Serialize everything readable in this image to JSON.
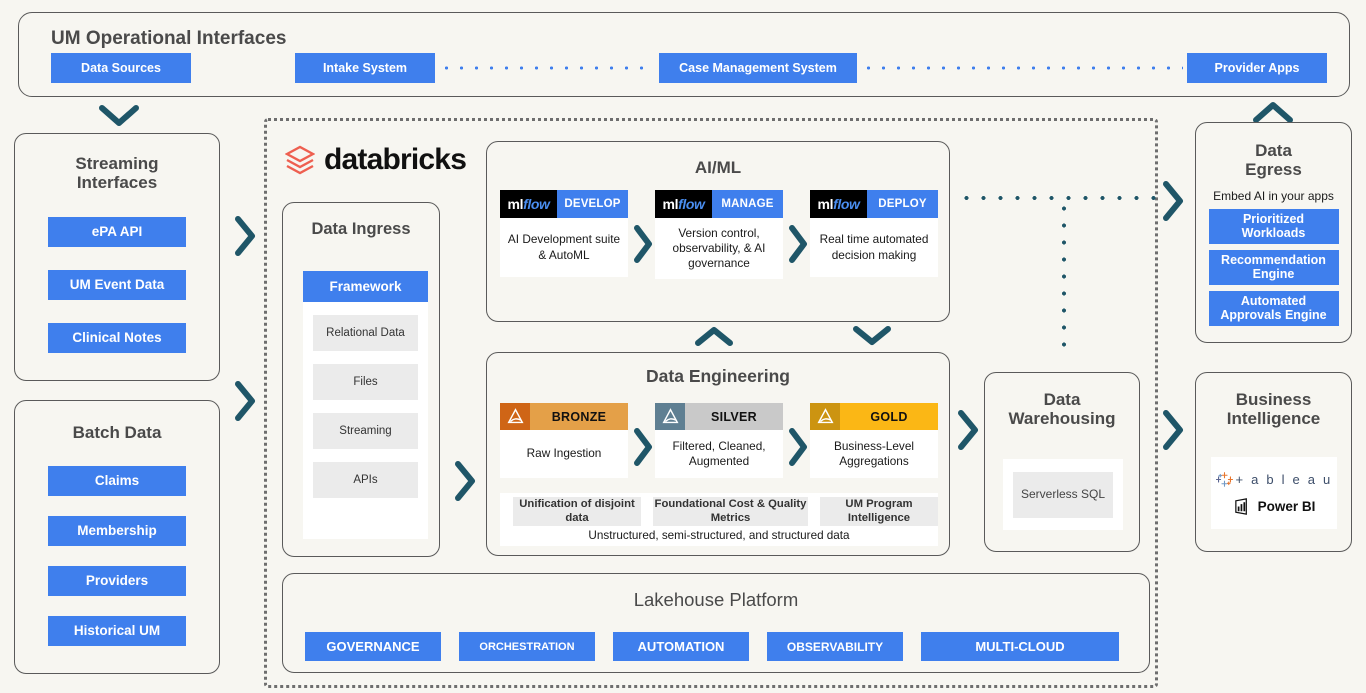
{
  "header": {
    "title": "UM Operational Interfaces",
    "chips": [
      {
        "label": "Data Sources"
      },
      {
        "label": "Intake System"
      },
      {
        "label": "Case Management System"
      },
      {
        "label": "Provider Apps"
      }
    ]
  },
  "streaming": {
    "title_line1": "Streaming",
    "title_line2": "Interfaces",
    "items": [
      {
        "label": "ePA API"
      },
      {
        "label": "UM Event Data"
      },
      {
        "label": "Clinical Notes"
      }
    ]
  },
  "batch": {
    "title": "Batch Data",
    "items": [
      {
        "label": "Claims"
      },
      {
        "label": "Membership"
      },
      {
        "label": "Providers"
      },
      {
        "label": "Historical UM"
      }
    ]
  },
  "databricks": {
    "wordmark": "databricks",
    "logo_color": "#ee5f50"
  },
  "ingress": {
    "title": "Data Ingress",
    "framework_label": "Framework",
    "items": [
      {
        "label": "Relational Data"
      },
      {
        "label": "Files"
      },
      {
        "label": "Streaming"
      },
      {
        "label": "APIs"
      }
    ]
  },
  "aiml": {
    "title": "AI/ML",
    "cards": [
      {
        "logo_ml": "ml",
        "logo_flow": "flow",
        "tag": "DEVELOP",
        "body": "AI Development suite & AutoML"
      },
      {
        "logo_ml": "ml",
        "logo_flow": "flow",
        "tag": "MANAGE",
        "body": "Version control, observability, & AI governance"
      },
      {
        "logo_ml": "ml",
        "logo_flow": "flow",
        "tag": "DEPLOY",
        "body": "Real time automated decision making"
      }
    ]
  },
  "data_engineering": {
    "title": "Data Engineering",
    "tiers": [
      {
        "tag": "BRONZE",
        "body": "Raw Ingestion",
        "icon_color": "#cf6516",
        "tag_color": "#e4a048"
      },
      {
        "tag": "SILVER",
        "body": "Filtered, Cleaned, Augmented",
        "icon_color": "#5f7f92",
        "tag_color": "#c9c9c9"
      },
      {
        "tag": "GOLD",
        "body": "Business-Level Aggregations",
        "icon_color": "#cc9411",
        "tag_color": "#fbb715"
      }
    ],
    "pills": [
      {
        "label": "Unification of disjoint data"
      },
      {
        "label": "Foundational Cost & Quality Metrics"
      },
      {
        "label": "UM Program Intelligence"
      }
    ],
    "note": "Unstructured, semi-structured, and structured data"
  },
  "data_warehousing": {
    "title_line1": "Data",
    "title_line2": "Warehousing",
    "item": "Serverless SQL"
  },
  "lakehouse": {
    "title": "Lakehouse Platform",
    "chips": [
      {
        "label": "GOVERNANCE"
      },
      {
        "label": "ORCHESTRATION"
      },
      {
        "label": "AUTOMATION"
      },
      {
        "label": "OBSERVABILITY"
      },
      {
        "label": "MULTI-CLOUD"
      }
    ]
  },
  "data_egress": {
    "title_line1": "Data",
    "title_line2": "Egress",
    "subtitle": "Embed AI in your apps",
    "items": [
      {
        "label": "Prioritized Workloads"
      },
      {
        "label": "Recommendation Engine"
      },
      {
        "label": "Automated Approvals Engine"
      }
    ]
  },
  "business_intelligence": {
    "title_line1": "Business",
    "title_line2": "Intelligence",
    "tools": [
      {
        "name": "tableau",
        "label": "+ a b l e a u"
      },
      {
        "name": "power-bi",
        "label": "Power BI"
      }
    ]
  },
  "colors": {
    "accent_blue": "#3f7fed",
    "connector_teal": "#1f5668",
    "panel_bg": "#f7f6f1",
    "panel_border": "#5a5a5a"
  }
}
